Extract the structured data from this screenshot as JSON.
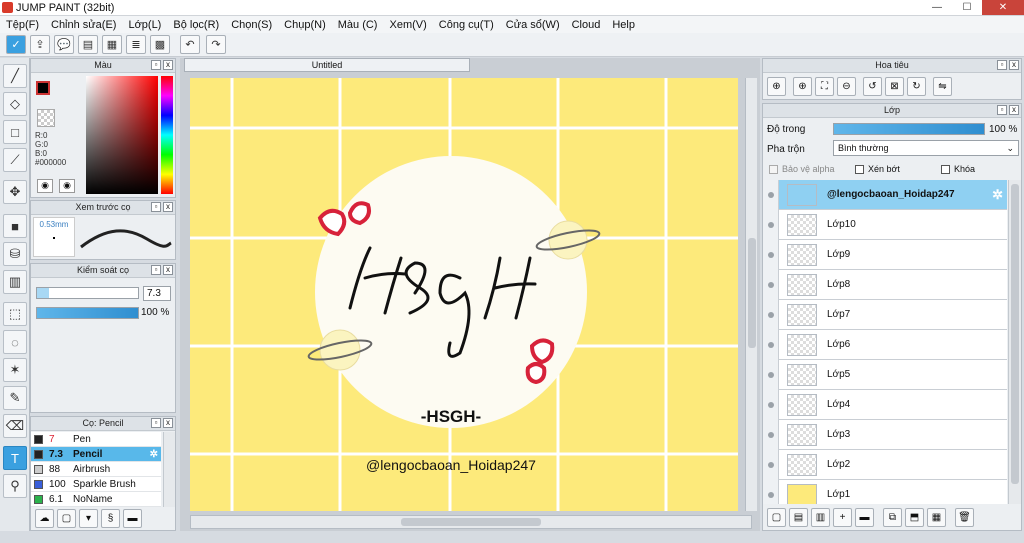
{
  "window": {
    "title": "JUMP PAINT (32bit)",
    "min": "—",
    "max": "☐",
    "close": "✕"
  },
  "menu": [
    "Tệp(F)",
    "Chỉnh sửa(E)",
    "Lớp(L)",
    "Bộ lọc(R)",
    "Chọn(S)",
    "Chụp(N)",
    "Màu (C)",
    "Xem(V)",
    "Công cụ(T)",
    "Cửa sổ(W)",
    "Cloud",
    "Help"
  ],
  "document": {
    "tab": "Untitled"
  },
  "artwork": {
    "title": "HSGH",
    "subtitle": "-HSGH-",
    "handle": "@lengocbaoan_Hoidap247",
    "bg_color": "#fdea7b"
  },
  "color_panel": {
    "title": "Màu",
    "r": "R:0",
    "g": "G:0",
    "b": "B:0",
    "hex": "#000000"
  },
  "brush_preview": {
    "title": "Xem trước cọ",
    "size": "0.53mm"
  },
  "brush_control": {
    "title": "Kiểm soát cọ",
    "size_value": "7.3",
    "opacity_value": "100 %"
  },
  "brush_panel": {
    "title": "Cọ: Pencil",
    "items": [
      {
        "size": "7",
        "name": "Pen",
        "color": "#222222"
      },
      {
        "size": "7.3",
        "name": "Pencil",
        "color": "#222222"
      },
      {
        "size": "88",
        "name": "Airbrush",
        "color": "#cccccc"
      },
      {
        "size": "100",
        "name": "Sparkle Brush",
        "color": "#3a5fd9"
      },
      {
        "size": "6.1",
        "name": "NoName",
        "color": "#2bb24c"
      }
    ]
  },
  "navigator": {
    "title": "Hoa tiêu"
  },
  "layers": {
    "title": "Lớp",
    "opacity_label": "Độ trong",
    "opacity_value": "100 %",
    "blend_label": "Pha trộn",
    "blend_value": "Bình thường",
    "protect_alpha": "Bảo vệ alpha",
    "clipping": "Xén bớt",
    "lock": "Khóa",
    "items": [
      "@lengocbaoan_Hoidap247",
      "Lớp10",
      "Lớp9",
      "Lớp8",
      "Lớp7",
      "Lớp6",
      "Lớp5",
      "Lớp4",
      "Lớp3",
      "Lớp2",
      "Lớp1"
    ]
  },
  "colors": {
    "accent": "#3aa0e0",
    "selected_row": "#58b8ea",
    "selected_layer": "#8fd0f2"
  }
}
